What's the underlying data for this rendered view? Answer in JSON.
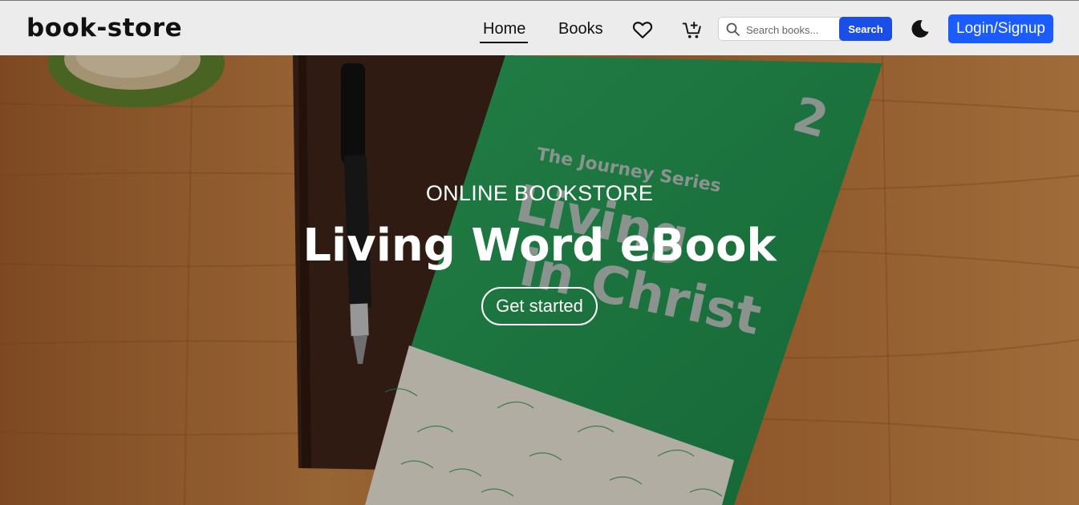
{
  "navbar": {
    "brand": "book-store",
    "links": {
      "home": "Home",
      "books": "Books"
    },
    "icons": {
      "wishlist": "heart-icon",
      "cart": "cart-add-icon",
      "theme": "moon-icon",
      "search": "search-icon"
    },
    "search": {
      "placeholder": "Search books...",
      "button": "Search"
    },
    "login": "Login/Signup"
  },
  "hero": {
    "subtitle": "ONLINE BOOKSTORE",
    "title": "Living Word eBook",
    "cta": "Get started",
    "book_cover": {
      "series": "The Journey Series",
      "title_line1": "Living",
      "title_line2": "in Christ",
      "number": "2"
    }
  },
  "colors": {
    "primary": "#1a5cff",
    "search_button": "#1a4ee6",
    "navbar_bg": "#ececec",
    "book_green": "#1f8a4a",
    "wood": "#b8743a"
  }
}
